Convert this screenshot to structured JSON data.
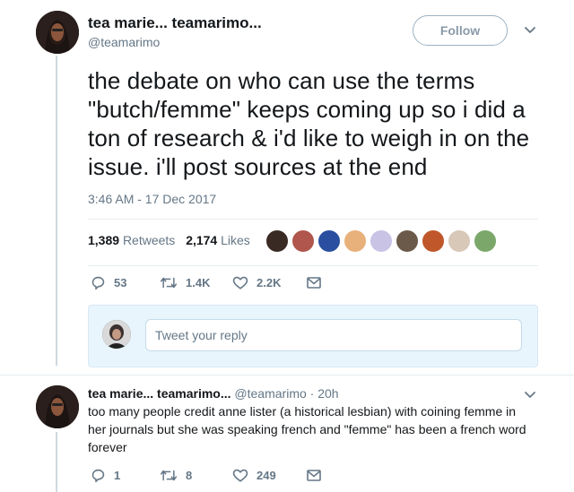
{
  "tweet": {
    "display_name": "tea marie... teamarimo...",
    "handle": "@teamarimo",
    "follow_label": "Follow",
    "text": "the debate on who can use the terms \"butch/femme\" keeps coming up so i did a ton of research & i'd like to weigh in on the issue. i'll post sources at the end",
    "timestamp": "3:46 AM - 17 Dec 2017",
    "retweets_count": "1,389",
    "retweets_label": "Retweets",
    "likes_count": "2,174",
    "likes_label": "Likes",
    "actions": {
      "reply_count": "53",
      "retweet_count": "1.4K",
      "like_count": "2.2K"
    },
    "colors": {
      "text": "#14171a",
      "secondary": "#657786",
      "reply_box_bg": "#e8f5fd",
      "divider": "#e6ecf0"
    }
  },
  "reply_composer": {
    "placeholder": "Tweet your reply"
  },
  "reply_tweet": {
    "display_name": "tea marie... teamarimo...",
    "meta": "@teamarimo · 20h",
    "text": "too many people credit anne lister (a historical lesbian) with coining femme in her journals but she was speaking french and \"femme\" has been a french word forever",
    "actions": {
      "reply_count": "1",
      "retweet_count": "8",
      "like_count": "249"
    }
  },
  "icons": {
    "caret": "chevron-down-icon",
    "reply": "reply-icon",
    "retweet": "retweet-icon",
    "like": "heart-icon",
    "dm": "envelope-icon"
  }
}
